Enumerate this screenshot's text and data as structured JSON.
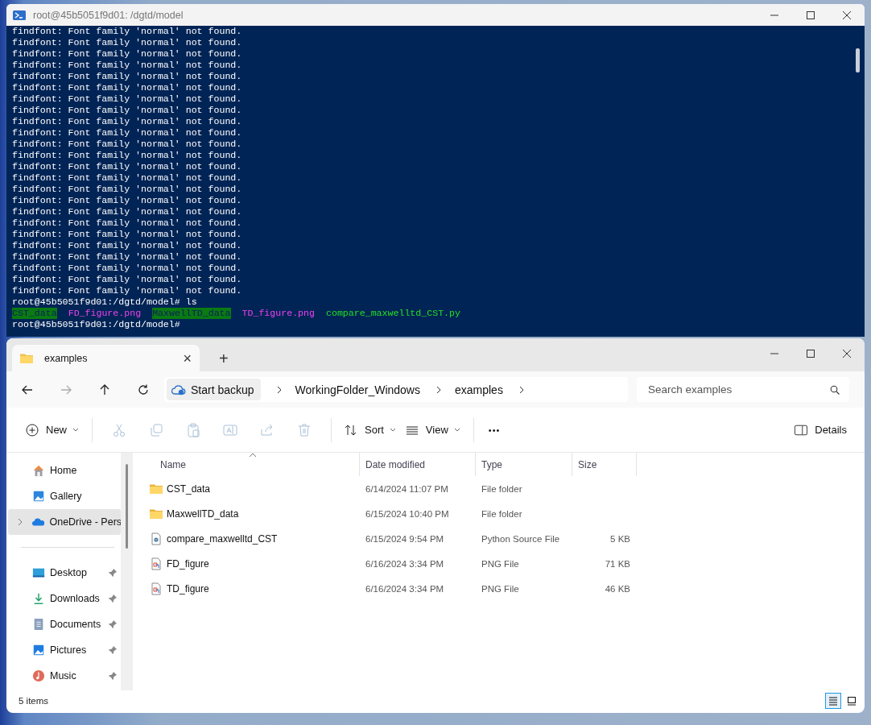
{
  "terminal": {
    "title": "root@45b5051f9d01: /dgtd/model",
    "lines": [
      "findfont: Font family 'normal' not found.",
      "findfont: Font family 'normal' not found.",
      "findfont: Font family 'normal' not found.",
      "findfont: Font family 'normal' not found.",
      "findfont: Font family 'normal' not found.",
      "findfont: Font family 'normal' not found.",
      "findfont: Font family 'normal' not found.",
      "findfont: Font family 'normal' not found.",
      "findfont: Font family 'normal' not found.",
      "findfont: Font family 'normal' not found.",
      "findfont: Font family 'normal' not found.",
      "findfont: Font family 'normal' not found.",
      "findfont: Font family 'normal' not found.",
      "findfont: Font family 'normal' not found.",
      "findfont: Font family 'normal' not found.",
      "findfont: Font family 'normal' not found.",
      "findfont: Font family 'normal' not found.",
      "findfont: Font family 'normal' not found.",
      "findfont: Font family 'normal' not found.",
      "findfont: Font family 'normal' not found.",
      "findfont: Font family 'normal' not found.",
      "findfont: Font family 'normal' not found.",
      "findfont: Font family 'normal' not found.",
      "findfont: Font family 'normal' not found.",
      "root@45b5051f9d01:/dgtd/model# ls"
    ],
    "ls_entries": [
      {
        "name": "CST_data",
        "kind": "dir"
      },
      {
        "name": "FD_figure.png",
        "kind": "image"
      },
      {
        "name": "MaxwellTD_data",
        "kind": "dir"
      },
      {
        "name": "TD_figure.png",
        "kind": "image"
      },
      {
        "name": "compare_maxwelltd_CST.py",
        "kind": "exec"
      }
    ],
    "prompt": "root@45b5051f9d01:/dgtd/model#"
  },
  "explorer": {
    "tab": {
      "label": "examples",
      "close": "×"
    },
    "new_tab": "+",
    "backup": "Start backup",
    "breadcrumbs": [
      "WorkingFolder_Windows",
      "examples"
    ],
    "search": {
      "placeholder": "Search examples"
    },
    "toolbar": {
      "new": "New",
      "sort": "Sort",
      "view": "View",
      "more": "•••",
      "details": "Details",
      "actions": [
        {
          "kind": "cut",
          "disabled": true
        },
        {
          "kind": "copy",
          "disabled": true
        },
        {
          "kind": "paste",
          "disabled": true
        },
        {
          "kind": "rename",
          "disabled": true
        },
        {
          "kind": "share",
          "disabled": true
        },
        {
          "kind": "delete",
          "disabled": true
        }
      ]
    },
    "sidebar": {
      "top": [
        {
          "label": "Home",
          "kind": "home",
          "selected": false,
          "expandable": false
        },
        {
          "label": "Gallery",
          "kind": "gallery",
          "selected": false,
          "expandable": false
        },
        {
          "label": "OneDrive - Pers",
          "kind": "cloud",
          "selected": true,
          "expandable": true
        }
      ],
      "pinned": [
        {
          "label": "Desktop",
          "kind": "desktop",
          "pinned": true
        },
        {
          "label": "Downloads",
          "kind": "downloads",
          "pinned": true
        },
        {
          "label": "Documents",
          "kind": "documents",
          "pinned": true
        },
        {
          "label": "Pictures",
          "kind": "pictures",
          "pinned": true
        },
        {
          "label": "Music",
          "kind": "music",
          "pinned": true
        }
      ]
    },
    "table": {
      "columns": [
        {
          "label": "Name",
          "sorted": true
        },
        {
          "label": "Date modified",
          "sorted": false
        },
        {
          "label": "Type",
          "sorted": false
        },
        {
          "label": "Size",
          "sorted": false
        }
      ],
      "rows": [
        {
          "name": "CST_data",
          "date": "6/14/2024 11:07 PM",
          "type": "File folder",
          "size": "",
          "kind": "folder"
        },
        {
          "name": "MaxwellTD_data",
          "date": "6/15/2024 10:40 PM",
          "type": "File folder",
          "size": "",
          "kind": "folder"
        },
        {
          "name": "compare_maxwelltd_CST",
          "date": "6/15/2024 9:54 PM",
          "type": "Python Source File",
          "size": "5 KB",
          "kind": "python"
        },
        {
          "name": "FD_figure",
          "date": "6/16/2024 3:34 PM",
          "type": "PNG File",
          "size": "71 KB",
          "kind": "image"
        },
        {
          "name": "TD_figure",
          "date": "6/16/2024 3:34 PM",
          "type": "PNG File",
          "size": "46 KB",
          "kind": "image"
        }
      ]
    },
    "status": "5 items",
    "views": [
      {
        "kind": "details",
        "selected": true
      },
      {
        "kind": "tiles",
        "selected": false
      }
    ]
  }
}
